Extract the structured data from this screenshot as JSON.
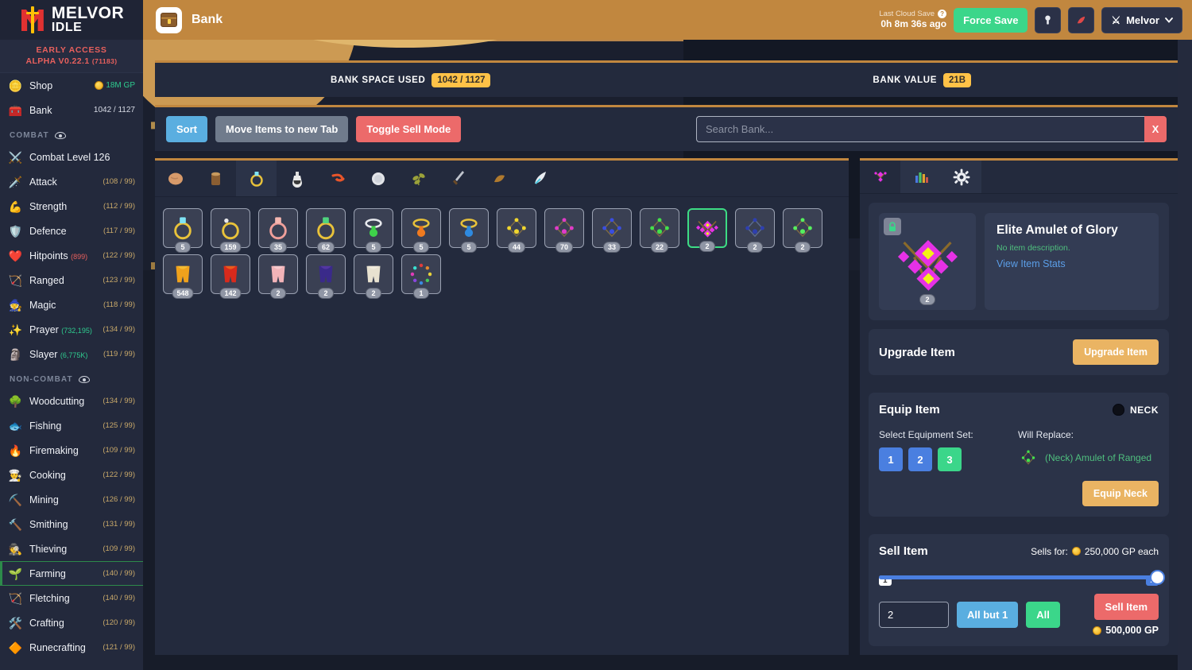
{
  "brand": {
    "line1": "MELVOR",
    "line2": "IDLE",
    "early_access": "EARLY ACCESS",
    "version": "ALPHA V0.22.1",
    "build": "(71183)"
  },
  "sidebar": {
    "shop": {
      "label": "Shop",
      "value": "18M GP",
      "icon": "coin-icon"
    },
    "bank": {
      "label": "Bank",
      "value": "1042 / 1127",
      "icon": "chest-icon"
    },
    "combat_header": "COMBAT",
    "noncombat_header": "NON-COMBAT",
    "combat": [
      {
        "label": "Combat Level 126",
        "icon": "crossed-swords-icon",
        "level": ""
      },
      {
        "label": "Attack",
        "icon": "sword-icon",
        "level": "(108 / 99)"
      },
      {
        "label": "Strength",
        "icon": "muscle-icon",
        "level": "(112 / 99)"
      },
      {
        "label": "Defence",
        "icon": "shield-icon",
        "level": "(117 / 99)"
      },
      {
        "label": "Hitpoints",
        "icon": "heart-icon",
        "level": "(122 / 99)",
        "sub": "(899)",
        "sub_color": "red"
      },
      {
        "label": "Ranged",
        "icon": "bow-icon",
        "level": "(123 / 99)"
      },
      {
        "label": "Magic",
        "icon": "wizard-hat-icon",
        "level": "(118 / 99)"
      },
      {
        "label": "Prayer",
        "icon": "prayer-star-icon",
        "level": "(134 / 99)",
        "sub": "(732,195)",
        "sub_color": "green"
      },
      {
        "label": "Slayer",
        "icon": "slayer-icon",
        "level": "(119 / 99)",
        "sub": "(6,775K)",
        "sub_color": "green"
      }
    ],
    "noncombat": [
      {
        "label": "Woodcutting",
        "icon": "tree-icon",
        "level": "(134 / 99)"
      },
      {
        "label": "Fishing",
        "icon": "fish-icon",
        "level": "(125 / 99)"
      },
      {
        "label": "Firemaking",
        "icon": "fire-icon",
        "level": "(109 / 99)"
      },
      {
        "label": "Cooking",
        "icon": "chef-hat-icon",
        "level": "(122 / 99)"
      },
      {
        "label": "Mining",
        "icon": "pickaxe-icon",
        "level": "(126 / 99)"
      },
      {
        "label": "Smithing",
        "icon": "anvil-icon",
        "level": "(131 / 99)"
      },
      {
        "label": "Thieving",
        "icon": "thief-icon",
        "level": "(109 / 99)"
      },
      {
        "label": "Farming",
        "icon": "seedling-icon",
        "level": "(140 / 99)",
        "active": true
      },
      {
        "label": "Fletching",
        "icon": "arrow-icon",
        "level": "(140 / 99)"
      },
      {
        "label": "Crafting",
        "icon": "tools-icon",
        "level": "(120 / 99)"
      },
      {
        "label": "Runecrafting",
        "icon": "rune-icon",
        "level": "(121 / 99)"
      }
    ]
  },
  "topbar": {
    "title": "Bank",
    "icon": "chest-icon",
    "cloud_save_label": "Last Cloud Save",
    "cloud_save_time": "0h 8m 36s ago",
    "force_save": "Force Save",
    "btn1_icon": "mastery-icon",
    "btn2_icon": "potion-icon",
    "account_name": "Melvor",
    "account_icon": "crossed-swords-icon",
    "chevron": "chevron-down-icon"
  },
  "stats": {
    "space_label": "BANK SPACE USED",
    "space_value": "1042 / 1127",
    "value_label": "BANK VALUE",
    "value_value": "21B"
  },
  "actions": {
    "sort": "Sort",
    "move": "Move Items to new Tab",
    "sell_mode": "Toggle Sell Mode",
    "search_placeholder": "Search Bank...",
    "search_value": "",
    "clear": "X"
  },
  "bank_tabs": [
    {
      "icon": "potato-icon",
      "selected": false
    },
    {
      "icon": "log-icon",
      "selected": false
    },
    {
      "icon": "ring-icon",
      "selected": true
    },
    {
      "icon": "potion-icon",
      "selected": false
    },
    {
      "icon": "shrimp-icon",
      "selected": false
    },
    {
      "icon": "silver-bar-icon",
      "selected": false
    },
    {
      "icon": "herb-icon",
      "selected": false
    },
    {
      "icon": "dagger-icon",
      "selected": false
    },
    {
      "icon": "leather-icon",
      "selected": false
    },
    {
      "icon": "feather-icon",
      "selected": false
    }
  ],
  "side_tabs": [
    {
      "icon": "amulet-icon",
      "selected": true
    },
    {
      "icon": "bar-chart-icon",
      "selected": false
    },
    {
      "icon": "gear-icon",
      "selected": false
    }
  ],
  "items": [
    {
      "icon": "ring-diamond",
      "qty": "5"
    },
    {
      "icon": "ring-gold-plain",
      "qty": "159"
    },
    {
      "icon": "ring-rose",
      "qty": "35"
    },
    {
      "icon": "ring-gold-emerald",
      "qty": "62"
    },
    {
      "icon": "amulet-silver-green",
      "qty": "5"
    },
    {
      "icon": "amulet-gold-orange",
      "qty": "5"
    },
    {
      "icon": "amulet-gold-blue",
      "qty": "5"
    },
    {
      "icon": "amulet-yellow-cluster",
      "qty": "44"
    },
    {
      "icon": "amulet-magenta-cluster",
      "qty": "70"
    },
    {
      "icon": "amulet-blue-cluster",
      "qty": "33"
    },
    {
      "icon": "amulet-green-cluster",
      "qty": "22"
    },
    {
      "icon": "amulet-elite-glory",
      "qty": "2",
      "selected": true
    },
    {
      "icon": "amulet-dark-blue-cluster",
      "qty": "2"
    },
    {
      "icon": "amulet-green-gem",
      "qty": "2"
    },
    {
      "icon": "cape-gold",
      "qty": "548"
    },
    {
      "icon": "cape-red",
      "qty": "142"
    },
    {
      "icon": "cape-pink",
      "qty": "2"
    },
    {
      "icon": "cape-purple",
      "qty": "2"
    },
    {
      "icon": "cape-white",
      "qty": "2"
    },
    {
      "icon": "cape-rainbow-ring",
      "qty": "1"
    }
  ],
  "selected_item": {
    "name": "Elite Amulet of Glory",
    "description": "No item description.",
    "stats_link": "View Item Stats",
    "qty": "2",
    "lock_icon": "lock-icon"
  },
  "upgrade": {
    "title": "Upgrade Item",
    "button": "Upgrade Item"
  },
  "equip": {
    "title": "Equip Item",
    "slot_label": "NECK",
    "slot_icon": "neck-icon",
    "set_label": "Select Equipment Set:",
    "sets": [
      "1",
      "2",
      "3"
    ],
    "active_set": "3",
    "replace_label": "Will Replace:",
    "replace_item": "(Neck) Amulet of Ranged",
    "replace_icon": "amulet-green-cluster",
    "equip_button": "Equip Neck"
  },
  "sell": {
    "title": "Sell Item",
    "sells_for_label": "Sells for:",
    "sells_for_value": "250,000 GP each",
    "slider_min": "1",
    "slider_max": "2",
    "slider_value": 2,
    "qty_value": "2",
    "all_but_one": "All but 1",
    "all": "All",
    "sell_button": "Sell Item",
    "total": "500,000 GP"
  },
  "colors": {
    "accent_orange": "#c1873f",
    "panel": "#232a3d",
    "card": "#2b3348",
    "green": "#3bd68a",
    "blue": "#5aaee0",
    "red": "#ec6a6a",
    "gold": "#ffc247"
  }
}
